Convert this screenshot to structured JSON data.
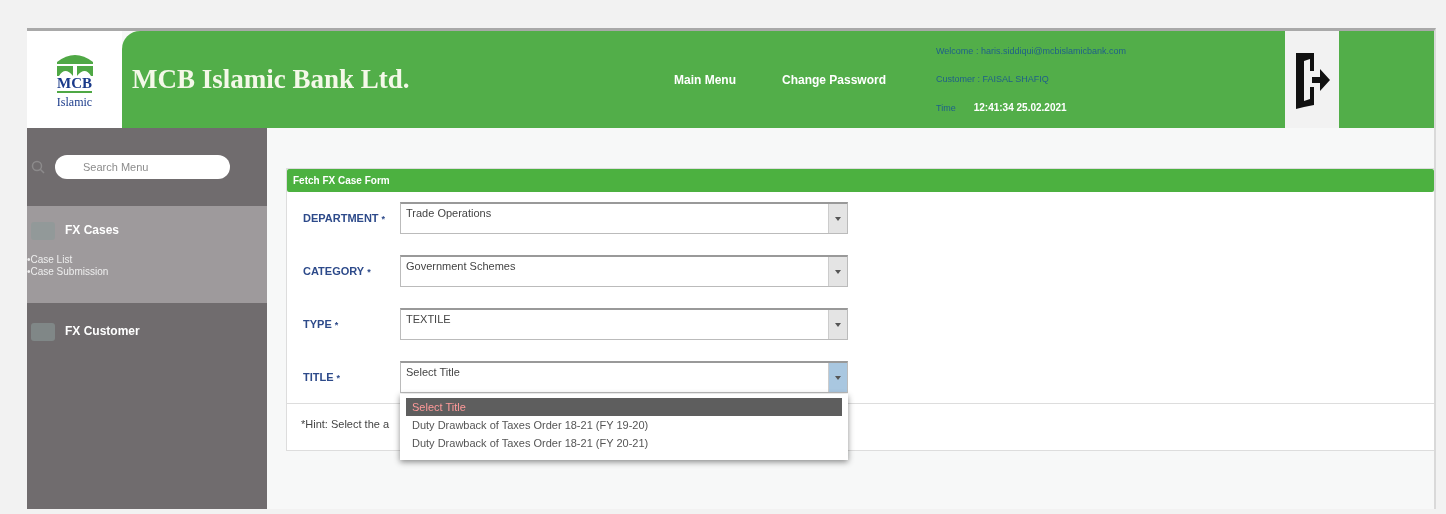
{
  "header": {
    "logo": {
      "mark": "MCB",
      "sub": "Islamic"
    },
    "bank_name": "MCB Islamic Bank Ltd.",
    "nav": [
      {
        "label": "Main Menu"
      },
      {
        "label": "Change Password"
      }
    ],
    "user_info": {
      "welcome": "Welcome : haris.siddiqui@mcbislamicbank.com",
      "customer": "Customer : FAISAL SHAFIQ",
      "time_label": "Time",
      "time_value": "12:41:34 25.02.2021"
    }
  },
  "sidebar": {
    "search": {
      "placeholder": "Search Menu"
    },
    "sections": [
      {
        "label": "FX Cases",
        "expanded": true,
        "children": [
          {
            "label": "•Case List"
          },
          {
            "label": "•Case Submission"
          }
        ]
      },
      {
        "label": "FX Customer",
        "expanded": false
      }
    ]
  },
  "form": {
    "title": "Fetch FX Case Form",
    "fields": [
      {
        "label": "DEPARTMENT",
        "required_mark": "*",
        "value": "Trade Operations",
        "open": false
      },
      {
        "label": "CATEGORY",
        "required_mark": "*",
        "value": "Government Schemes",
        "open": false
      },
      {
        "label": "TYPE",
        "required_mark": "*",
        "value": "TEXTILE",
        "open": false
      },
      {
        "label": "TITLE",
        "required_mark": "*",
        "value": "Select Title",
        "open": true,
        "options": [
          {
            "label": "Select Title",
            "selected": true
          },
          {
            "label": "Duty Drawback of Taxes Order 18-21 (FY 19-20)",
            "selected": false
          },
          {
            "label": "Duty Drawback of Taxes Order 18-21 (FY 20-21)",
            "selected": false
          }
        ]
      }
    ],
    "hint": "*Hint: Select the a"
  }
}
